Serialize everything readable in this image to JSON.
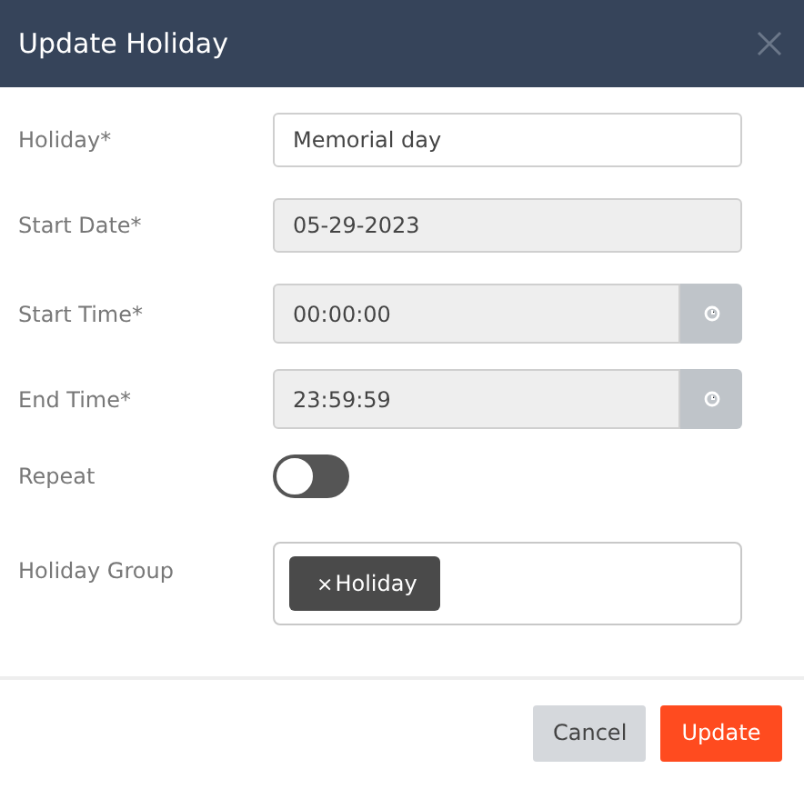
{
  "dialog": {
    "title": "Update Holiday"
  },
  "fields": [
    {
      "kind": "text",
      "label": "Holiday*",
      "value": "Memorial day"
    },
    {
      "kind": "readonly",
      "label": "Start Date*",
      "value": "05-29-2023"
    },
    {
      "kind": "time",
      "label": "Start Time*",
      "value": "00:00:00"
    },
    {
      "kind": "time",
      "label": "End Time*",
      "value": "23:59:59"
    },
    {
      "kind": "toggle",
      "label": "Repeat",
      "on": false
    },
    {
      "kind": "tags",
      "label": "Holiday Group",
      "tags": [
        {
          "remove": "×",
          "label": "Holiday"
        }
      ]
    }
  ],
  "buttons": [
    {
      "kind": "secondary",
      "label": "Cancel"
    },
    {
      "kind": "primary",
      "label": "Update"
    }
  ]
}
